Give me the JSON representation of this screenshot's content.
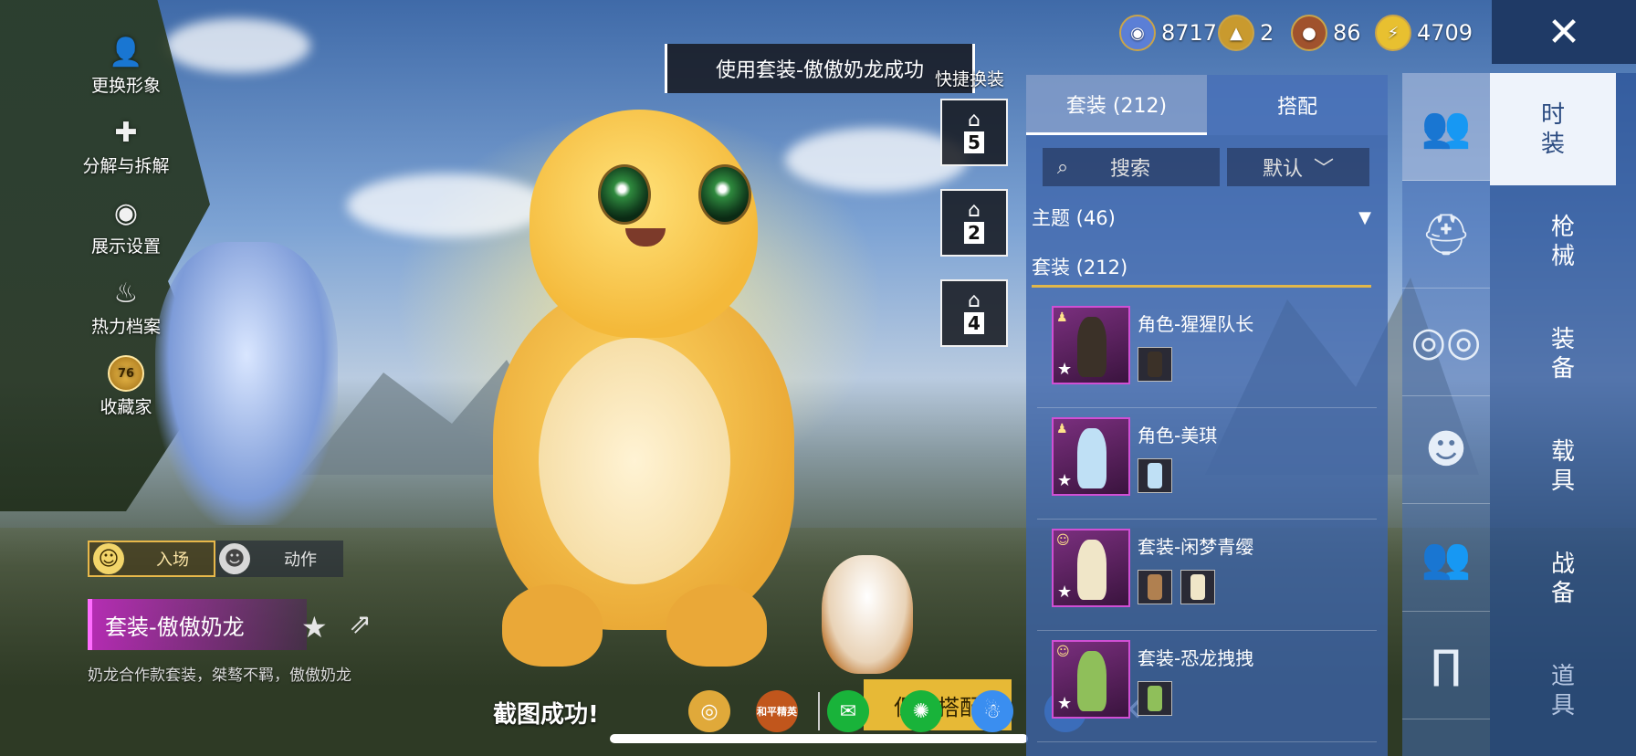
{
  "left_menu": [
    {
      "label": "更换形象",
      "icon": "person-icon"
    },
    {
      "label": "分解与拆解",
      "icon": "puzzle-icon"
    },
    {
      "label": "展示设置",
      "icon": "eye-icon"
    },
    {
      "label": "热力档案",
      "icon": "flame-icon"
    },
    {
      "label": "收藏家",
      "icon": "level-badge-icon",
      "badge": "76"
    }
  ],
  "mode_tabs": [
    {
      "label": "入场",
      "active": true
    },
    {
      "label": "动作",
      "active": false
    }
  ],
  "current_suit": {
    "name": "套装-傲傲奶龙",
    "description": "奶龙合作款套装，桀骜不羁，傲傲奶龙"
  },
  "toast": "使用套装-傲傲奶龙成功",
  "quick_change_label": "快捷换装",
  "presets": [
    "5",
    "2",
    "4"
  ],
  "screenshot_bar": {
    "status": "截图成功!",
    "save_label": "保存搭配",
    "share_targets": [
      "qq-friends-icon",
      "game-logo-icon",
      "wechat-icon",
      "moments-icon",
      "qq-icon",
      "qzone-icon"
    ],
    "share_logo_text": "和平精英"
  },
  "currencies": [
    {
      "icon": "silver-coin-icon",
      "value": "8717",
      "color": "#5b7fd6"
    },
    {
      "icon": "gold-badge-icon",
      "value": "2",
      "color": "#c99a2e"
    },
    {
      "icon": "bronze-coin-icon",
      "value": "86",
      "color": "#a0522d"
    },
    {
      "icon": "lightning-coin-icon",
      "value": "4709",
      "color": "#e8c030"
    }
  ],
  "panel": {
    "tabs": [
      {
        "label": "套装 (212)",
        "active": true
      },
      {
        "label": "搭配",
        "active": false
      }
    ],
    "search_placeholder": "搜索",
    "sort_label": "默认",
    "theme_row": "主题 (46)",
    "suit_row": "套装 (212)",
    "items": [
      {
        "name": "角色-猩猩队长",
        "fig_color": "#3b3128",
        "minis": 1
      },
      {
        "name": "角色-美琪",
        "fig_color": "#bfe0f5",
        "minis": 1
      },
      {
        "name": "套装-闲梦青缨",
        "fig_color": "#f0e6c8",
        "minis": 2
      },
      {
        "name": "套装-恐龙拽拽",
        "fig_color": "#8fbf5a",
        "minis": 1
      }
    ]
  },
  "category_column": [
    {
      "icon": "twin-figures-icon",
      "active": true
    },
    {
      "icon": "cap-icon",
      "active": false
    },
    {
      "icon": "glasses-icon",
      "active": false
    },
    {
      "icon": "face-mask-icon",
      "active": false
    },
    {
      "icon": "twin-figures-icon",
      "active": false
    },
    {
      "icon": "pants-icon",
      "active": false
    }
  ],
  "main_tabs": [
    {
      "label": "时装",
      "active": true
    },
    {
      "label": "枪械",
      "active": false
    },
    {
      "label": "装备",
      "active": false
    },
    {
      "label": "载具",
      "active": false
    },
    {
      "label": "战备",
      "active": false
    },
    {
      "label": "道具",
      "active": false
    }
  ]
}
